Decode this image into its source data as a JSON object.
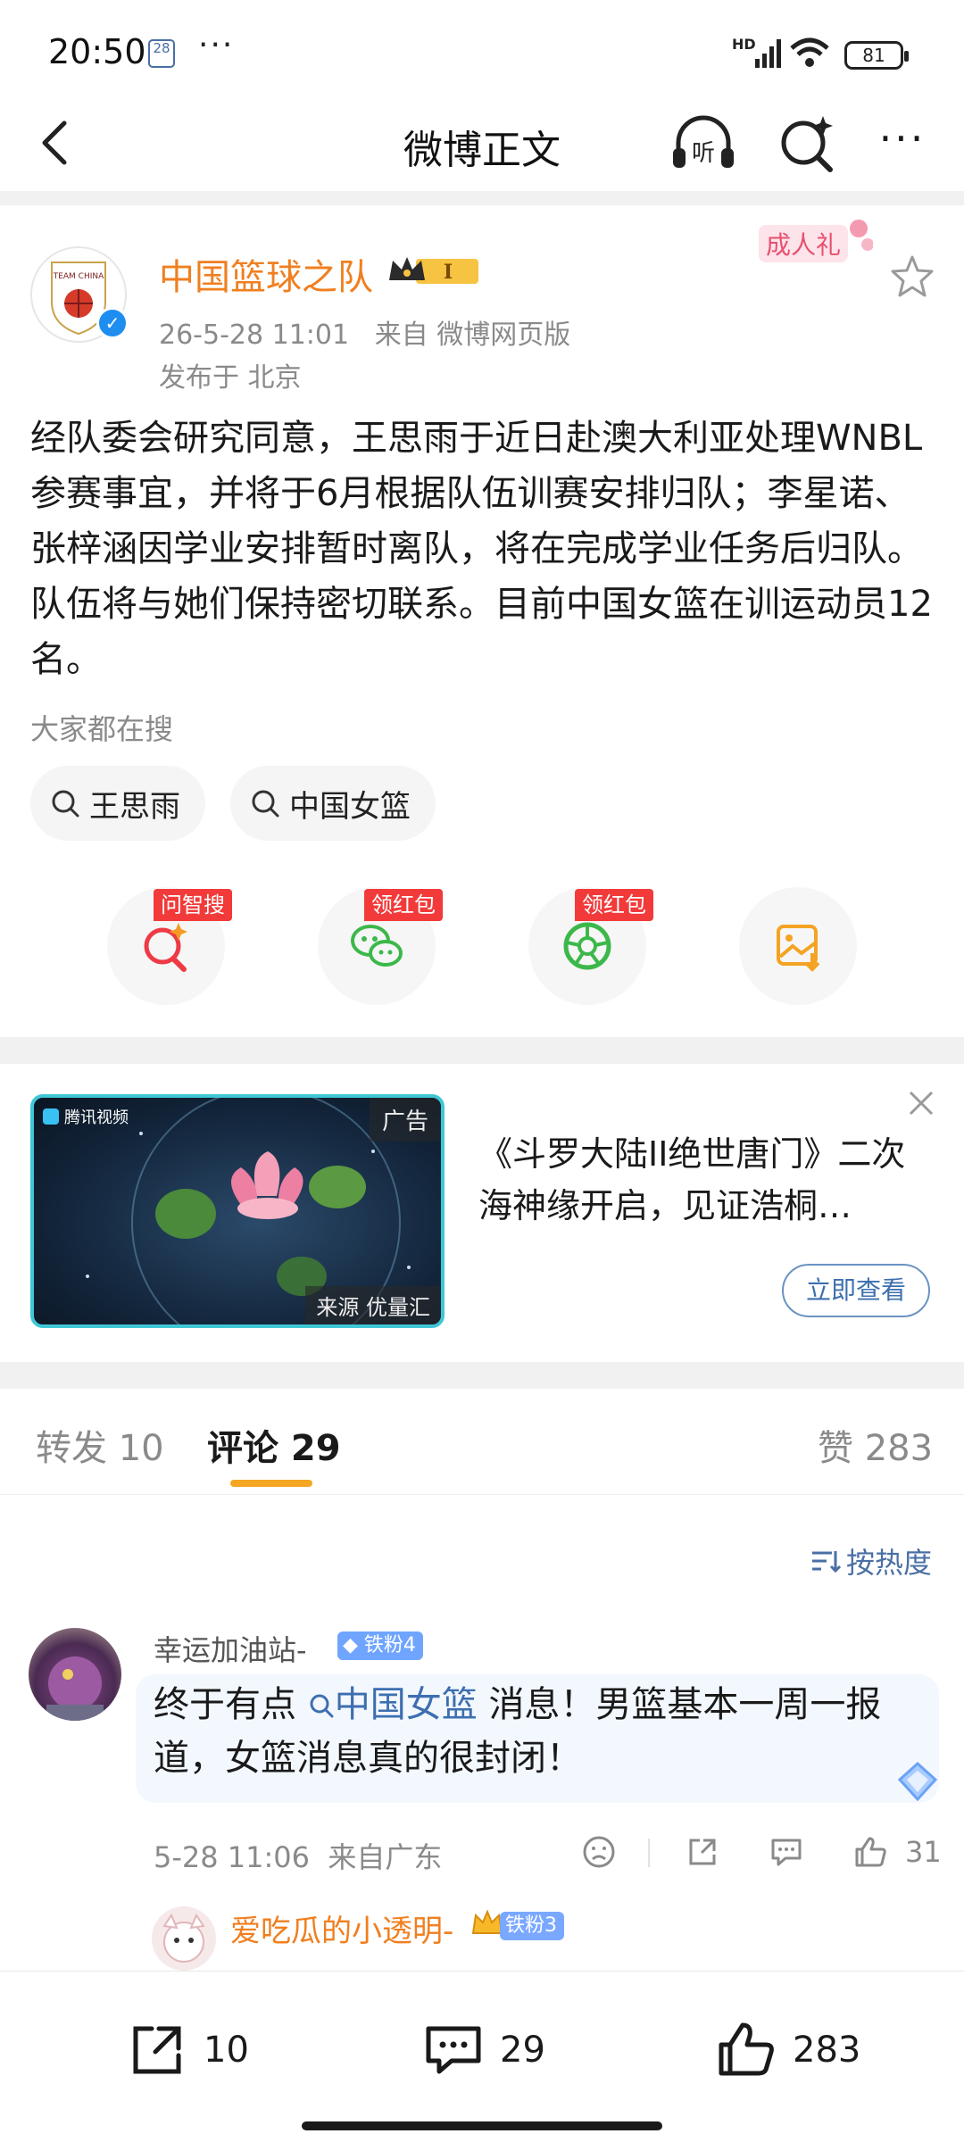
{
  "status_bar": {
    "time": "20:50",
    "date_badge": "28",
    "battery": "81",
    "network": "HD"
  },
  "nav": {
    "title": "微博正文"
  },
  "post": {
    "author": "中国篮球之队",
    "level": "I",
    "time": "26-5-28 11:01",
    "source": "来自 微博网页版",
    "location": "发布于 北京",
    "coming_of_age_badge": "成人礼",
    "avatar_text": "TEAM CHINA",
    "body": "经队委会研究同意，王思雨于近日赴澳大利亚处理WNBL参赛事宜，并将于6月根据队伍训赛安排归队；李星诺、张梓涵因学业安排暂时离队，将在完成学业任务后归队。队伍将与她们保持密切联系。目前中国女篮在训运动员12名。"
  },
  "hot_search": {
    "label": "大家都在搜",
    "chips": [
      "王思雨",
      "中国女篮"
    ]
  },
  "actions": [
    {
      "tag": "问智搜",
      "icon": "ai-search-icon"
    },
    {
      "tag": "领红包",
      "icon": "wechat-icon"
    },
    {
      "tag": "领红包",
      "icon": "moments-icon"
    },
    {
      "tag": "",
      "icon": "save-image-icon"
    }
  ],
  "ad": {
    "tag": "广告",
    "source": "来源 优量汇",
    "app": "腾讯视频",
    "title": "《斗罗大陆II绝世唐门》二次海神缘开启，见证浩桐…",
    "button": "立即查看"
  },
  "tabs": {
    "repost": "转发 10",
    "comments": "评论 29",
    "likes": "赞 283"
  },
  "sort": "按热度",
  "comment": {
    "user": "幸运加油站-",
    "badge": "铁粉4",
    "text_before": "终于有点",
    "topic": "中国女篮",
    "text_after": " 消息！男篮基本一周一报道，女篮消息真的很封闭！",
    "time": "5-28 11:06",
    "location": "来自广东",
    "like_count": "31"
  },
  "reply": {
    "user": "爱吃瓜的小透明-",
    "badge": "铁粉3"
  },
  "bottom_bar": {
    "repost_count": "10",
    "comment_count": "29",
    "like_count": "283"
  },
  "colors": {
    "accent_orange": "#f07f20",
    "link_blue": "#3d6fb0",
    "tag_red": "#f23a3a",
    "tab_indicator": "#f5a623"
  }
}
